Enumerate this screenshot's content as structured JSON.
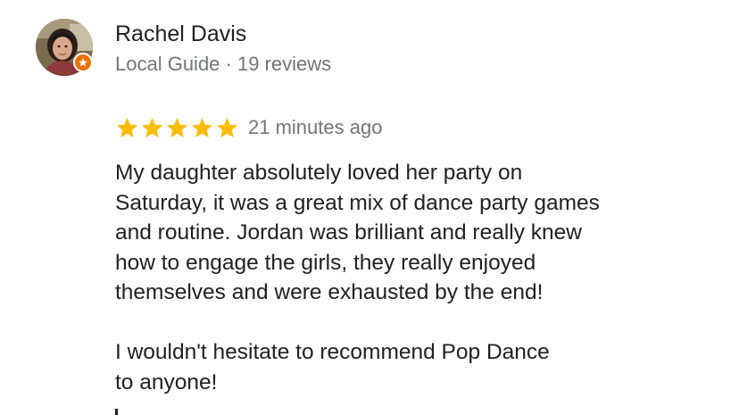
{
  "reviewer": {
    "name": "Rachel Davis",
    "meta": "Local Guide · 19 reviews",
    "avatar_icon": "profile-photo",
    "badge_icon": "local-guide-star-icon",
    "badge_color": "#e8710a"
  },
  "review": {
    "rating": 5,
    "rating_max": 5,
    "star_color": "#fbbc04",
    "time": "21 minutes ago",
    "paragraphs": [
      "My daughter absolutely loved her party on\nSaturday, it was a great mix of dance party games\nand routine. Jordan was brilliant and really knew\nhow to engage the girls, they really enjoyed\nthemselves and were exhausted by the end!",
      "I wouldn't hesitate to recommend Pop Dance\nto anyone!"
    ]
  }
}
